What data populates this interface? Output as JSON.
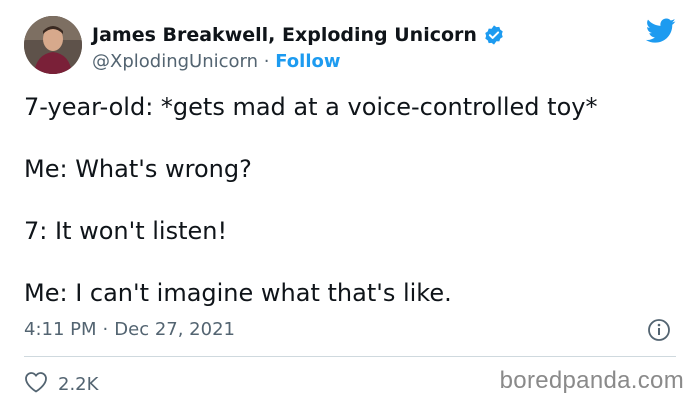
{
  "author": {
    "display_name": "James Breakwell, Exploding Unicorn",
    "handle": "@XplodingUnicorn",
    "separator": "·",
    "follow_label": "Follow"
  },
  "tweet": {
    "lines": [
      "7-year-old: *gets mad at a voice-controlled toy*",
      "Me: What's wrong?",
      "7: It won't listen!",
      "Me: I can't imagine what that's like."
    ],
    "time": "4:11 PM",
    "date": "Dec 27, 2021",
    "meta_separator": "·",
    "likes": "2.2K"
  },
  "watermark": "boredpanda.com",
  "icons": {
    "verified": "verified-badge-icon",
    "bird": "twitter-bird-icon",
    "info": "info-icon",
    "like": "heart-icon"
  },
  "colors": {
    "accent": "#1d9bf0",
    "text": "#0f1419",
    "muted": "#536471"
  }
}
